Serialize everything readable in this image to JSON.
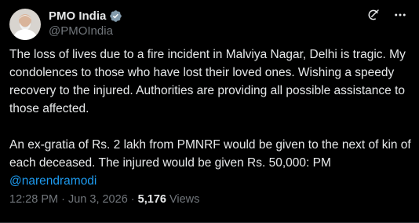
{
  "author": {
    "display_name": "PMO India",
    "handle": "@PMOIndia",
    "verified": true,
    "verified_icon": "verified-badge-icon",
    "avatar": "avatar"
  },
  "header_icons": [
    "grok-icon",
    "more-icon"
  ],
  "post": {
    "paragraph_1": "The loss of lives due to a fire incident in Malviya Nagar, Delhi is tragic. My condolences to those who have lost their loved ones. Wishing a speedy recovery to the injured. Authorities are providing all possible assistance to those affected.",
    "paragraph_2_text": "An ex-gratia of Rs. 2 lakh from PMNRF would be given to the next of kin of each deceased. The injured would be given Rs. 50,000: PM ",
    "paragraph_2_mention": "@narendramodi"
  },
  "meta": {
    "time": "12:28 PM",
    "separator": " · ",
    "date": "Jun 3, 2026",
    "views_count": "5,176",
    "views_label": " Views"
  },
  "colors": {
    "background": "#000000",
    "text": "#e7e9ea",
    "muted": "#71767b",
    "accent": "#1d9bf0"
  }
}
